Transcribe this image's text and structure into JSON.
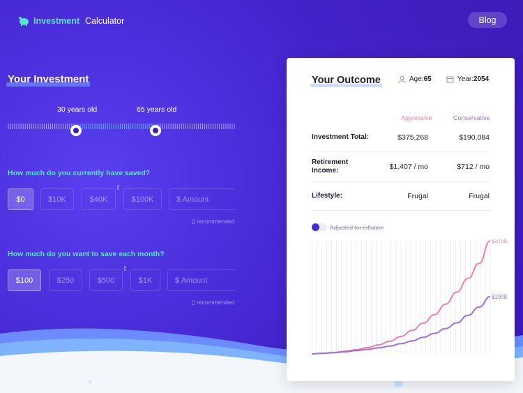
{
  "header": {
    "brand_bold": "Investment",
    "brand_rest": "Calculator",
    "blog_label": "Blog"
  },
  "investment": {
    "title": "Your Investment",
    "age_start_label": "30 years old",
    "age_end_label": "65 years old",
    "saved_question": "How much do you currently have saved?",
    "saved_options": [
      "$0",
      "$10K",
      "$40K",
      "$100K"
    ],
    "saved_selected": "$0",
    "saved_amount_placeholder": "$ Amount",
    "saved_recommended": "recommended",
    "monthly_question": "How much do you want to save each month?",
    "monthly_options": [
      "$100",
      "$250",
      "$500",
      "$1K"
    ],
    "monthly_selected": "$100",
    "monthly_amount_placeholder": "$ Amount",
    "monthly_recommended": "recommended"
  },
  "outcome": {
    "title": "Your Outcome",
    "age_label": "Age:",
    "age_value": "65",
    "year_label": "Year:",
    "year_value": "2054",
    "col_aggressive": "Aggressive",
    "col_conservative": "Conservative",
    "rows": [
      {
        "label": "Investment Total:",
        "aggressive": "$375,268",
        "conservative": "$190,084"
      },
      {
        "label": "Retirement Income:",
        "aggressive": "$1,407 / mo",
        "conservative": "$712 / mo"
      },
      {
        "label": "Lifestyle:",
        "aggressive": "Frugal",
        "conservative": "Frugal"
      }
    ],
    "inflation_label": "Adjusted for inflation"
  },
  "colors": {
    "accent_teal": "#55e6d6",
    "aggressive": "#ef7fb0",
    "conservative": "#9b6fe0",
    "background": "#4322c9"
  },
  "chart_data": {
    "type": "line",
    "series": [
      {
        "name": "Aggressive",
        "end_label": "$375K",
        "values": [
          0,
          2,
          5,
          9,
          14,
          21,
          30,
          42,
          58,
          78,
          102,
          130,
          165,
          205,
          250,
          300,
          375
        ]
      },
      {
        "name": "Conservative",
        "end_label": "$190K",
        "values": [
          0,
          2,
          4,
          7,
          11,
          15,
          20,
          26,
          34,
          43,
          55,
          68,
          84,
          103,
          128,
          155,
          190
        ]
      }
    ],
    "ylim": [
      0,
      375
    ],
    "grid": "vertical",
    "legend": "none"
  }
}
